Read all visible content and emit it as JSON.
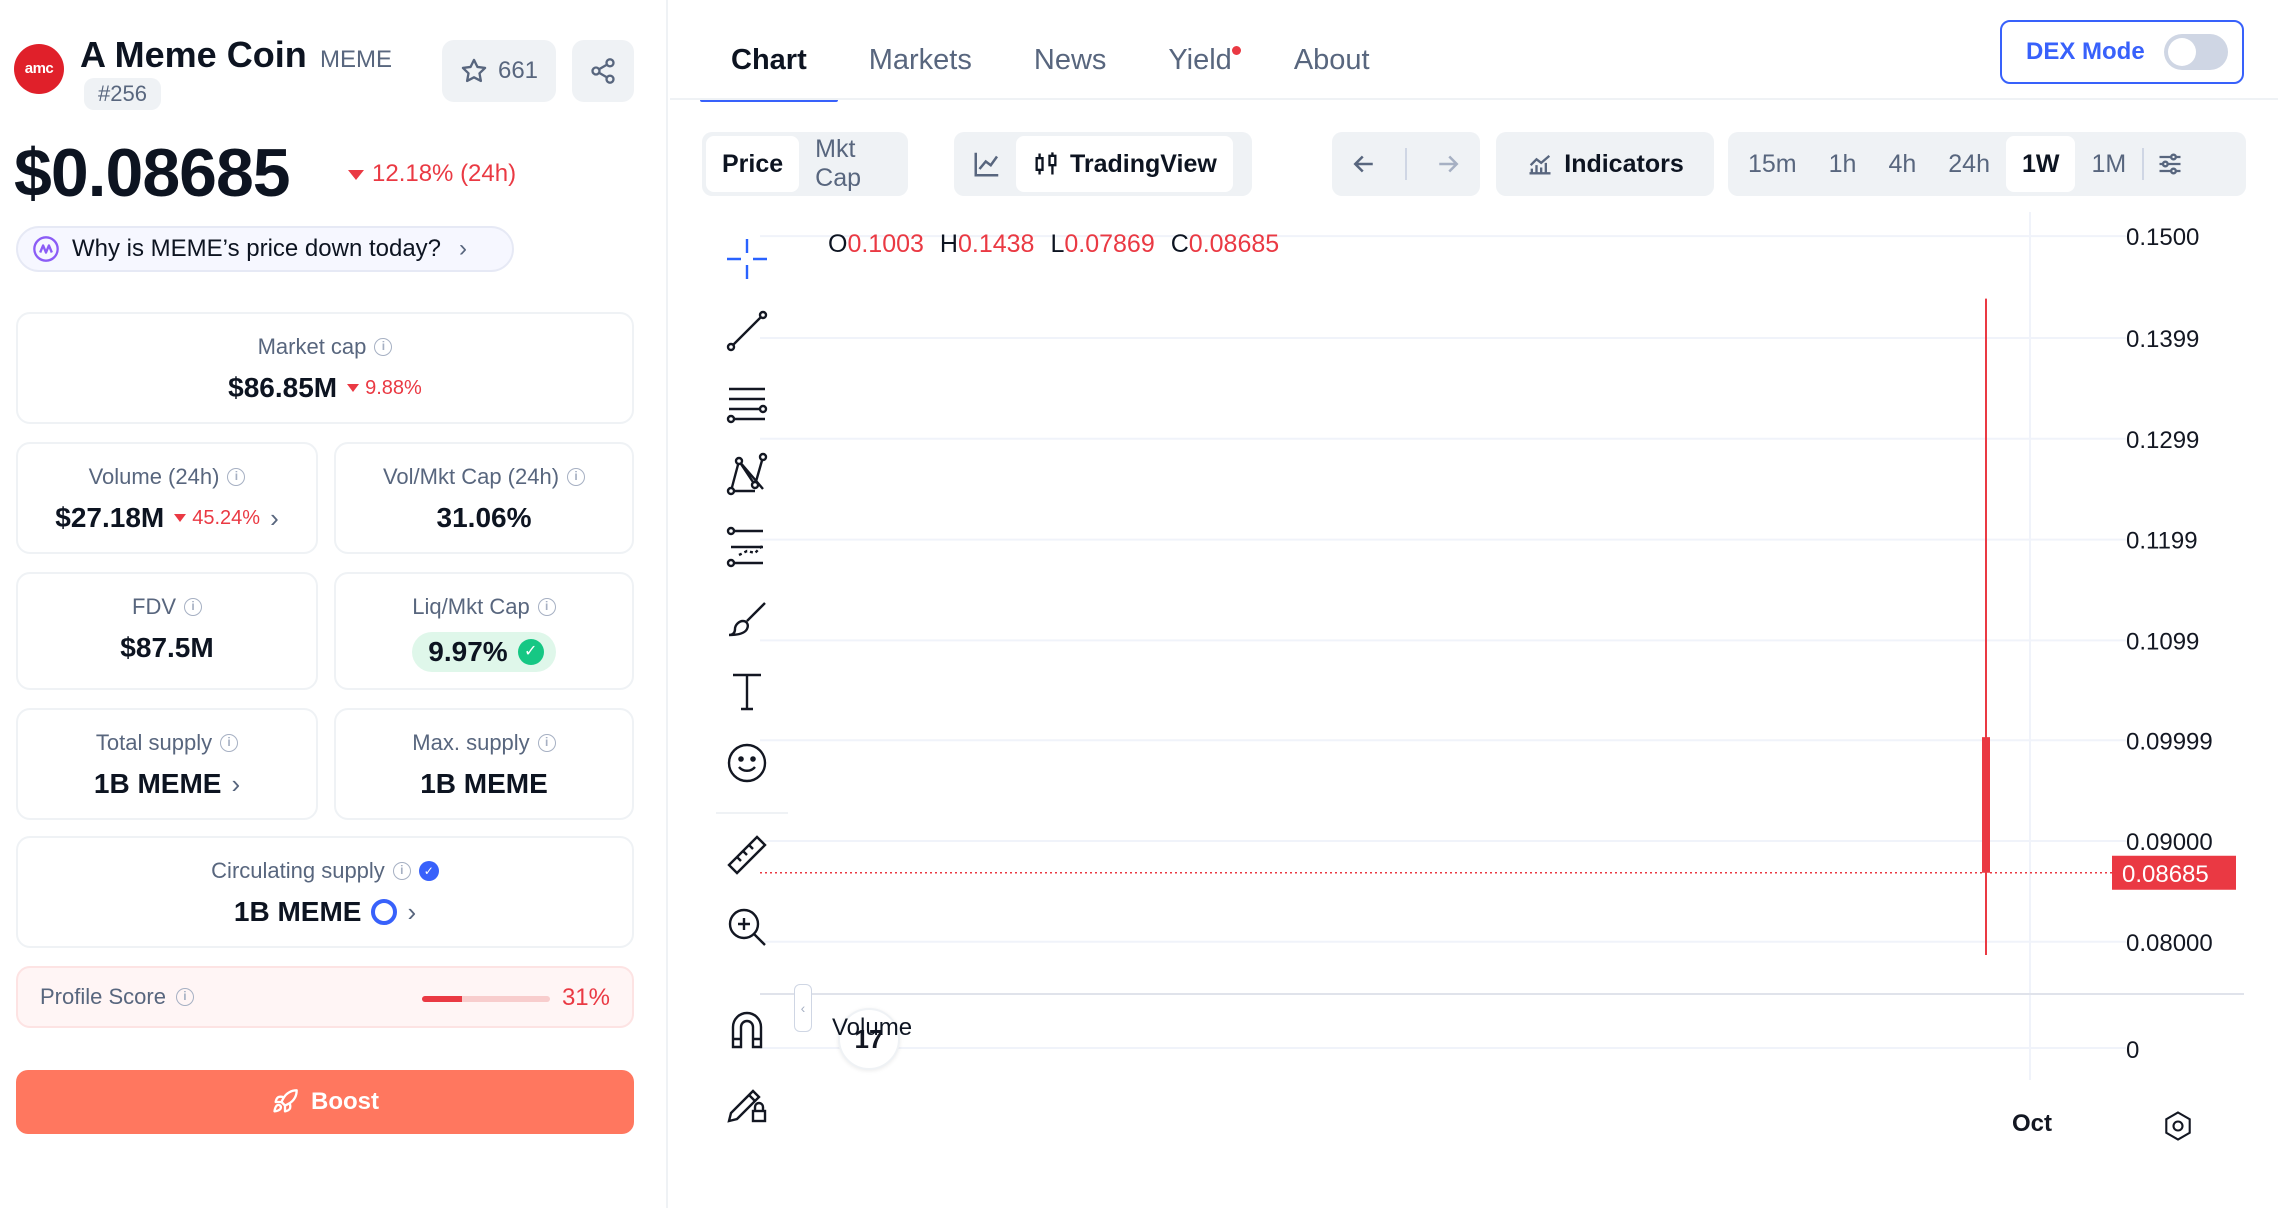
{
  "coin": {
    "logo_text": "amc",
    "name": "A Meme Coin",
    "symbol": "MEME",
    "rank": "#256",
    "watchlist_count": "661",
    "price": "$0.08685",
    "price_change": "12.18% (24h)",
    "why_text": "Why is MEME’s price down today?"
  },
  "stats": {
    "market_cap": {
      "label": "Market cap",
      "value": "$86.85M",
      "change": "9.88%"
    },
    "volume": {
      "label": "Volume (24h)",
      "value": "$27.18M",
      "change": "45.24%"
    },
    "vol_mkt": {
      "label": "Vol/Mkt Cap (24h)",
      "value": "31.06%"
    },
    "fdv": {
      "label": "FDV",
      "value": "$87.5M"
    },
    "liq_mkt": {
      "label": "Liq/Mkt Cap",
      "value": "9.97%"
    },
    "total_supply": {
      "label": "Total supply",
      "value": "1B MEME"
    },
    "max_supply": {
      "label": "Max. supply",
      "value": "1B MEME"
    },
    "circ_supply": {
      "label": "Circulating supply",
      "value": "1B MEME"
    }
  },
  "profile": {
    "label": "Profile Score",
    "value": "31%",
    "fill": 0.31
  },
  "boost_label": "Boost",
  "tabs": [
    "Chart",
    "Markets",
    "News",
    "Yield",
    "About"
  ],
  "dex_mode": {
    "label": "DEX Mode",
    "on": false
  },
  "chart_controls": {
    "price_toggle": [
      "Price",
      "Mkt Cap"
    ],
    "tradingview": "TradingView",
    "indicators": "Indicators",
    "timeframes": [
      "15m",
      "1h",
      "4h",
      "24h",
      "1W",
      "1M"
    ],
    "active_timeframe": "1W"
  },
  "chart_data": {
    "type": "candlestick",
    "ohlc_labels": {
      "O": "0.1003",
      "H": "0.1438",
      "L": "0.07869",
      "C": "0.08685"
    },
    "candles": [
      {
        "x": "late Sep",
        "open": 0.1003,
        "high": 0.1438,
        "low": 0.07869,
        "close": 0.08685
      }
    ],
    "y_ticks": [
      "0.1500",
      "0.1399",
      "0.1299",
      "0.1199",
      "0.1099",
      "0.09999",
      "0.09000",
      "0.08000"
    ],
    "ylim": [
      0.0776,
      0.1516
    ],
    "last_price_label": "0.08685",
    "x_ticks": [
      "Oct"
    ],
    "volume_label": "Volume",
    "volume_ticks": [
      "0"
    ],
    "grid": true,
    "colors": {
      "down": "#ea3943",
      "grid": "#f0f3fa",
      "axis_text": "#131722"
    }
  },
  "tv_logo": "17"
}
